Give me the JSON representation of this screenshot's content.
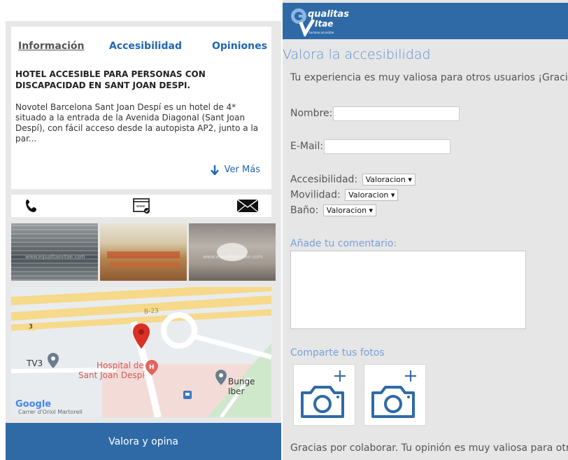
{
  "left": {
    "tabs": [
      "Información",
      "Accesibilidad",
      "Opiniones"
    ],
    "hotel_title": "HOTEL ACCESIBLE PARA PERSONAS CON DISCAPACIDAD EN SANT JOAN DESPI.",
    "hotel_description": "Novotel Barcelona Sant Joan Despí es un hotel de 4* situado a la entrada de la Avenida Diagonal (Sant Joan Despí), con fácil acceso desde la autopista AP2, junto a la par...",
    "ver_mas": "Ver Más",
    "photo_watermark": "www.equalitasvitae.com",
    "map": {
      "road_number": "3",
      "place_tv3": "TV3",
      "place_hospital_line1": "Hospital de",
      "place_hospital_line2": "Sant Joan Despí",
      "place_bunge": "Bunge Iber",
      "road_b23": "B-23",
      "google": "Google",
      "street": "Carrer d'Oriol Martorell"
    },
    "cta_label": "Valora y opina"
  },
  "right": {
    "logo_line1": "qualitas",
    "logo_line2": "Itae",
    "logo_tagline": "turismo accesible",
    "title": "Valora la accesibilidad",
    "intro": "Tu experiencia es muy valiosa para otros usuarios ¡Gracias",
    "nombre_label": "Nombre:",
    "email_label": "E-Mail:",
    "accesibilidad_label": "Accesibilidad:",
    "movilidad_label": "Movilidad:",
    "bano_label": "Baño:",
    "select_value": "Valoracion ▾",
    "comment_label": "Añade tu comentario:",
    "photos_label": "Comparte tus fotos",
    "footer": "Gracias por colaborar. Tu opinión es muy valiosa para otros"
  },
  "colors": {
    "brand_blue": "#2f6aa7",
    "link_blue": "#1f66b3",
    "light_blue": "#7a9fd8"
  }
}
